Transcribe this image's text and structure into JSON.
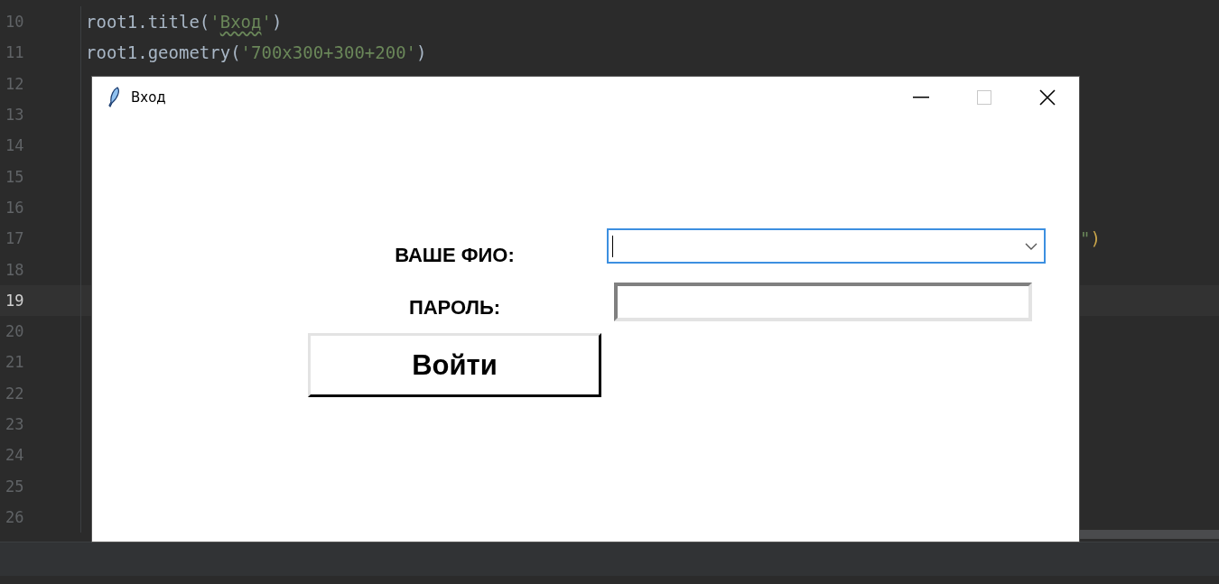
{
  "editor": {
    "lines": [
      {
        "number": "10",
        "current": false,
        "segments": [
          {
            "text": "root1.title(",
            "kind": "code"
          },
          {
            "text": "'",
            "kind": "string"
          },
          {
            "text": "Вход",
            "kind": "string",
            "warning": true
          },
          {
            "text": "'",
            "kind": "string"
          },
          {
            "text": ")",
            "kind": "code"
          }
        ]
      },
      {
        "number": "11",
        "current": false,
        "segments": [
          {
            "text": "root1.geometry(",
            "kind": "code"
          },
          {
            "text": "'700x300+300+200'",
            "kind": "string"
          },
          {
            "text": ")",
            "kind": "code"
          }
        ]
      },
      {
        "number": "12",
        "current": false
      },
      {
        "number": "13",
        "current": false
      },
      {
        "number": "14",
        "current": false
      },
      {
        "number": "15",
        "current": false
      },
      {
        "number": "16",
        "current": false
      },
      {
        "number": "17",
        "current": false,
        "tail": [
          {
            "text": "\"",
            "kind": "string"
          },
          {
            "text": ")",
            "kind": "bracket"
          }
        ]
      },
      {
        "number": "18",
        "current": false
      },
      {
        "number": "19",
        "current": true
      },
      {
        "number": "20",
        "current": false
      },
      {
        "number": "21",
        "current": false
      },
      {
        "number": "22",
        "current": false
      },
      {
        "number": "23",
        "current": false
      },
      {
        "number": "24",
        "current": false
      },
      {
        "number": "25",
        "current": false
      },
      {
        "number": "26",
        "current": false
      }
    ]
  },
  "window": {
    "title": "Вход"
  },
  "form": {
    "fields": [
      {
        "label": "ВАШЕ ФИО:",
        "kind": "combobox",
        "focused": true
      },
      {
        "label": "ПАРОЛЬ:",
        "kind": "password",
        "focused": false
      }
    ],
    "submit": "Войти"
  }
}
